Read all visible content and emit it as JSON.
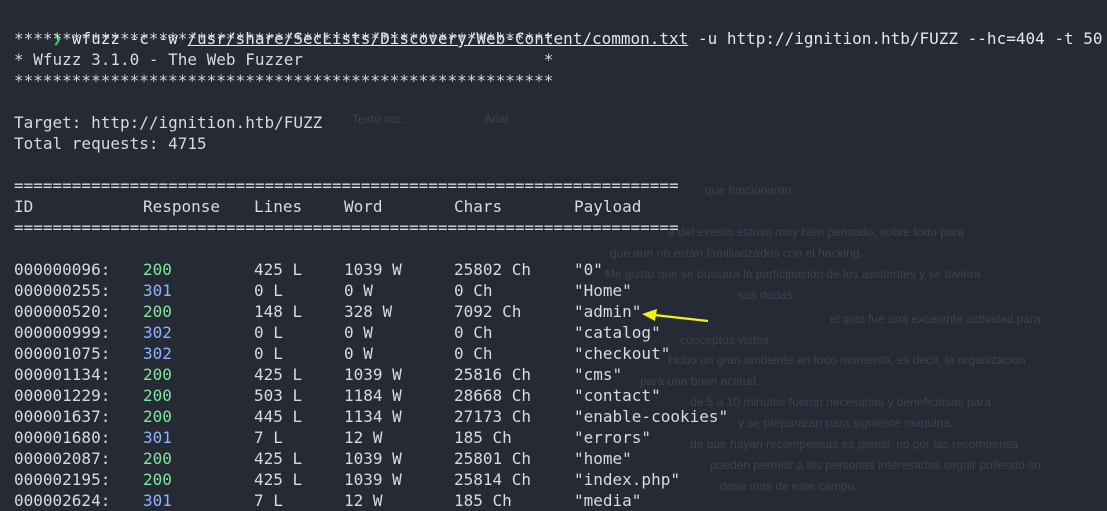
{
  "terminal": {
    "prompt_symbol": "❯",
    "command_prefix": "wfuzz -c -w ",
    "wordlist_path": "/usr/share/SecLists/Discovery/Web-Content/common.txt",
    "command_suffix": " -u http://ignition.htb/FUZZ --hc=404 -t 50",
    "banner_rule": "********************************************************",
    "banner_title": "* Wfuzz 3.1.0 - The Web Fuzzer                         *",
    "target_line": "Target: http://ignition.htb/FUZZ",
    "total_line": "Total requests: 4715",
    "table_rule": "=====================================================================",
    "headers": [
      "ID",
      "Response",
      "Lines",
      "Word",
      "Chars",
      "Payload"
    ],
    "rows": [
      {
        "id": "000000096:",
        "code": "200",
        "lines": "425 L",
        "words": "1039 W",
        "chars": "25802 Ch",
        "payload": "\"0\""
      },
      {
        "id": "000000255:",
        "code": "301",
        "lines": "0 L",
        "words": "0 W",
        "chars": "0 Ch",
        "payload": "\"Home\""
      },
      {
        "id": "000000520:",
        "code": "200",
        "lines": "148 L",
        "words": "328 W",
        "chars": "7092 Ch",
        "payload": "\"admin\""
      },
      {
        "id": "000000999:",
        "code": "302",
        "lines": "0 L",
        "words": "0 W",
        "chars": "0 Ch",
        "payload": "\"catalog\""
      },
      {
        "id": "000001075:",
        "code": "302",
        "lines": "0 L",
        "words": "0 W",
        "chars": "0 Ch",
        "payload": "\"checkout\""
      },
      {
        "id": "000001134:",
        "code": "200",
        "lines": "425 L",
        "words": "1039 W",
        "chars": "25816 Ch",
        "payload": "\"cms\""
      },
      {
        "id": "000001229:",
        "code": "200",
        "lines": "503 L",
        "words": "1184 W",
        "chars": "28668 Ch",
        "payload": "\"contact\""
      },
      {
        "id": "000001637:",
        "code": "200",
        "lines": "445 L",
        "words": "1134 W",
        "chars": "27173 Ch",
        "payload": "\"enable-cookies\""
      },
      {
        "id": "000001680:",
        "code": "301",
        "lines": "7 L",
        "words": "12 W",
        "chars": "185 Ch",
        "payload": "\"errors\""
      },
      {
        "id": "000002087:",
        "code": "200",
        "lines": "425 L",
        "words": "1039 W",
        "chars": "25801 Ch",
        "payload": "\"home\""
      },
      {
        "id": "000002195:",
        "code": "200",
        "lines": "425 L",
        "words": "1039 W",
        "chars": "25814 Ch",
        "payload": "\"index.php\""
      },
      {
        "id": "000002624:",
        "code": "301",
        "lines": "7 L",
        "words": "12 W",
        "chars": "185 Ch",
        "payload": "\"media\""
      }
    ]
  },
  "colors": {
    "background": "#252a35",
    "status_2xx": "#7ee7a0",
    "status_3xx": "#8fb4ff",
    "annotation_arrow": "#f2f21a"
  },
  "annotation": {
    "icon": "arrow-left-icon",
    "points_to_row": 2
  },
  "background_doc": [
    "Texto nor...",
    "Arial",
    "que funcionaron.",
    "a del evento estuvo muy bien pensado, sobre todo para",
    "que aun no estan familiarizados con el hacking.",
    "Me gusto que se buscara la participacion de los asistentes y se tuviera",
    "sus dudas.",
    "el quiz fue una excelente actividad para",
    "conceptos vistos.",
    "Hubo un gran ambiente en todo momento, es decir, la organizacion",
    "para una buen actitud.",
    "de 5 a 10 minutos fueron necesarias y beneficiosas para",
    "y se prepararan para siguiente maquina.",
    "de que hayan recompensas es genial, no por las recompensa",
    "pueden permitir a las personas interesadas seguir puliendo su",
    "dose mas de este campo."
  ]
}
